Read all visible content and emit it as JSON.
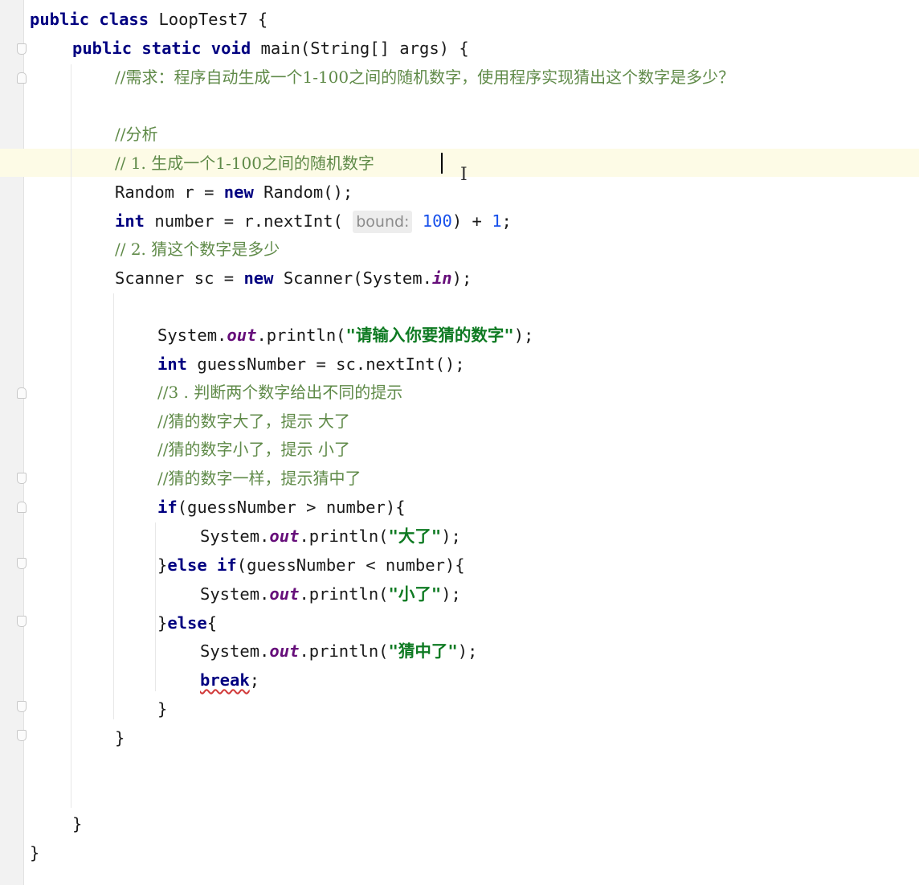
{
  "code": {
    "l1": {
      "kw": "public class",
      "rest": " LoopTest7 {"
    },
    "l2": {
      "kw": "public static void",
      "rest": " main(String[] args) {"
    },
    "l3": "//需求：程序自动生成一个1-100之间的随机数字，使用程序实现猜出这个数字是多少？",
    "l5": "//分析",
    "l6": "// 1. 生成一个1-100之间的随机数字",
    "l7": {
      "a": "Random r = ",
      "kw": "new",
      "b": " Random();"
    },
    "l8": {
      "kw": "int",
      "a": " number = r.nextInt( ",
      "hint": "bound:",
      "num1": " 100",
      "b": ") + ",
      "num2": "1",
      "c": ";"
    },
    "l9": "// 2. 猜这个数字是多少",
    "l10": {
      "a": "Scanner sc = ",
      "kw": "new",
      "b": " Scanner(System.",
      "fld": "in",
      "c": ");"
    },
    "l12": {
      "a": "System.",
      "fld": "out",
      "b": ".println(",
      "str": "\"请输入你要猜的数字\"",
      "c": ");"
    },
    "l13": {
      "kw": "int",
      "a": " guessNumber = sc.nextInt();"
    },
    "l14": "//3 . 判断两个数字给出不同的提示",
    "l15": "//猜的数字大了，提示 大了",
    "l16": "//猜的数字小了，提示 小了",
    "l17": "//猜的数字一样，提示猜中了",
    "l18": {
      "kw": "if",
      "a": "(guessNumber > number){"
    },
    "l19": {
      "a": "System.",
      "fld": "out",
      "b": ".println(",
      "str": "\"大了\"",
      "c": ");"
    },
    "l20": {
      "a": "}",
      "kw": "else if",
      "b": "(guessNumber < number){"
    },
    "l21": {
      "a": "System.",
      "fld": "out",
      "b": ".println(",
      "str": "\"小了\"",
      "c": ");"
    },
    "l22": {
      "a": "}",
      "kw": "else",
      "b": "{"
    },
    "l23": {
      "a": "System.",
      "fld": "out",
      "b": ".println(",
      "str": "\"猜中了\"",
      "c": ");"
    },
    "l24": {
      "kw": "break",
      "a": ";"
    },
    "l25": "}",
    "l26": "}",
    "l29": "}",
    "l30": "}"
  }
}
